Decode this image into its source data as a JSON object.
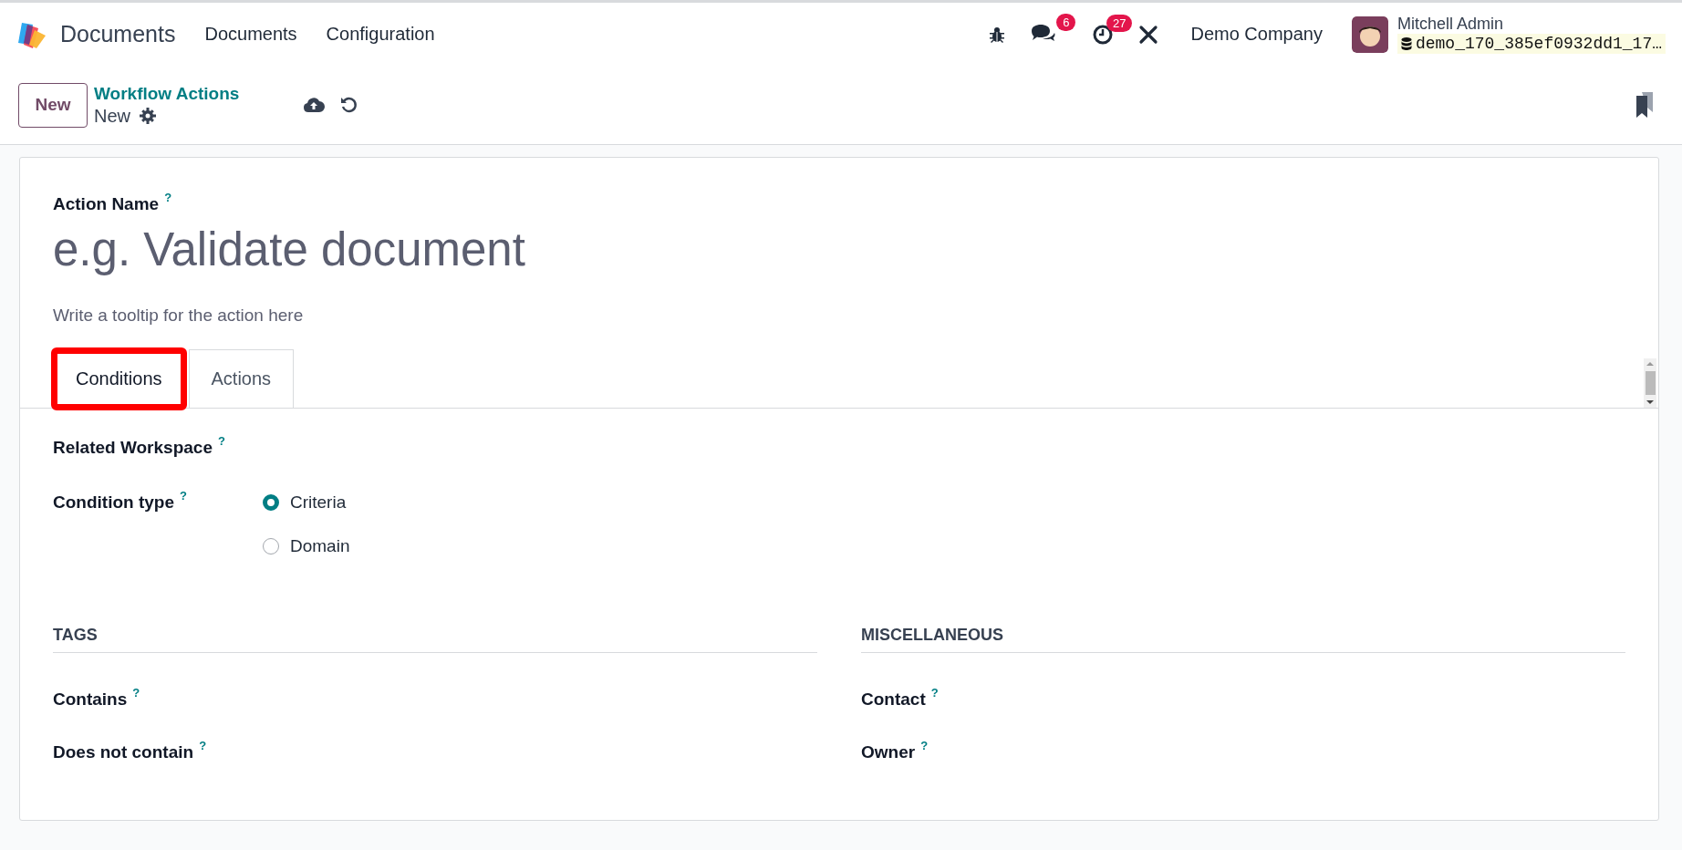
{
  "navbar": {
    "app_name": "Documents",
    "menu": [
      "Documents",
      "Configuration"
    ],
    "messages_count": "6",
    "activities_count": "27",
    "company": "Demo Company",
    "user": "Mitchell Admin",
    "database": "demo_170_385ef0932dd1_17…"
  },
  "control_panel": {
    "new_button": "New",
    "breadcrumb": "Workflow Actions",
    "record": "New"
  },
  "form": {
    "name_label": "Action Name",
    "name_help": "?",
    "name_placeholder": "e.g. Validate document",
    "tooltip_placeholder": "Write a tooltip for the action here",
    "tabs": [
      {
        "label": "Conditions",
        "selected": true,
        "highlighted": true
      },
      {
        "label": "Actions",
        "selected": false,
        "highlighted": false
      }
    ],
    "fields": [
      {
        "label": "Related Workspace",
        "help": "?",
        "kind": "empty"
      },
      {
        "label": "Condition type",
        "help": "?",
        "kind": "radio",
        "options": [
          {
            "label": "Criteria",
            "selected": true
          },
          {
            "label": "Domain",
            "selected": false
          }
        ]
      }
    ],
    "sections": [
      {
        "title": "TAGS",
        "fields": [
          {
            "label": "Contains",
            "help": "?"
          },
          {
            "label": "Does not contain",
            "help": "?"
          }
        ]
      },
      {
        "title": "MISCELLANEOUS",
        "fields": [
          {
            "label": "Contact",
            "help": "?"
          },
          {
            "label": "Owner",
            "help": "?"
          }
        ]
      }
    ]
  }
}
